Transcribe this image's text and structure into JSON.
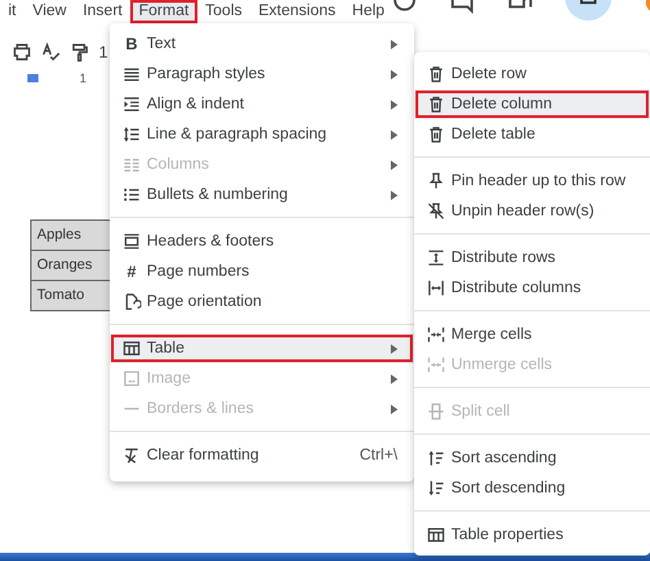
{
  "menubar": {
    "items": [
      {
        "label": "it",
        "selected": false
      },
      {
        "label": "View",
        "selected": false
      },
      {
        "label": "Insert",
        "selected": false
      },
      {
        "label": "Format",
        "selected": true
      },
      {
        "label": "Tools",
        "selected": false
      },
      {
        "label": "Extensions",
        "selected": false
      },
      {
        "label": "Help",
        "selected": false
      }
    ]
  },
  "toolbar": {
    "zoom_text": "1"
  },
  "ruler": {
    "mark": "1"
  },
  "document": {
    "table": {
      "rows": [
        "Apples",
        "Oranges",
        "Tomato"
      ]
    }
  },
  "format_menu": {
    "items": [
      {
        "kind": "item",
        "label": "Text",
        "icon_text": "B",
        "disabled": false,
        "highlighted": false,
        "has_submenu": true
      },
      {
        "kind": "item",
        "label": "Paragraph styles",
        "disabled": false,
        "highlighted": false,
        "has_submenu": true
      },
      {
        "kind": "item",
        "label": "Align & indent",
        "disabled": false,
        "highlighted": false,
        "has_submenu": true
      },
      {
        "kind": "item",
        "label": "Line & paragraph spacing",
        "disabled": false,
        "highlighted": false,
        "has_submenu": true
      },
      {
        "kind": "item",
        "label": "Columns",
        "disabled": true,
        "highlighted": false,
        "has_submenu": true
      },
      {
        "kind": "item",
        "label": "Bullets & numbering",
        "disabled": false,
        "highlighted": false,
        "has_submenu": true
      },
      {
        "kind": "divider"
      },
      {
        "kind": "item",
        "label": "Headers & footers",
        "disabled": false,
        "highlighted": false,
        "has_submenu": false
      },
      {
        "kind": "item",
        "label": "Page numbers",
        "icon_text": "#",
        "disabled": false,
        "highlighted": false,
        "has_submenu": false
      },
      {
        "kind": "item",
        "label": "Page orientation",
        "disabled": false,
        "highlighted": false,
        "has_submenu": false
      },
      {
        "kind": "divider"
      },
      {
        "kind": "item",
        "label": "Table",
        "disabled": false,
        "highlighted": true,
        "has_submenu": true
      },
      {
        "kind": "item",
        "label": "Image",
        "disabled": true,
        "highlighted": false,
        "has_submenu": true
      },
      {
        "kind": "item",
        "label": "Borders & lines",
        "disabled": true,
        "highlighted": false,
        "has_submenu": true
      },
      {
        "kind": "divider"
      },
      {
        "kind": "item",
        "label": "Clear formatting",
        "shortcut": "Ctrl+\\",
        "disabled": false,
        "highlighted": false,
        "has_submenu": false
      }
    ]
  },
  "table_submenu": {
    "items": [
      {
        "kind": "item",
        "label": "Delete row",
        "disabled": false,
        "highlighted": false
      },
      {
        "kind": "item",
        "label": "Delete column",
        "disabled": false,
        "highlighted": true
      },
      {
        "kind": "item",
        "label": "Delete table",
        "disabled": false,
        "highlighted": false
      },
      {
        "kind": "divider"
      },
      {
        "kind": "item",
        "label": "Pin header up to this row",
        "disabled": false,
        "highlighted": false
      },
      {
        "kind": "item",
        "label": "Unpin header row(s)",
        "disabled": false,
        "highlighted": false
      },
      {
        "kind": "divider"
      },
      {
        "kind": "item",
        "label": "Distribute rows",
        "disabled": false,
        "highlighted": false
      },
      {
        "kind": "item",
        "label": "Distribute columns",
        "disabled": false,
        "highlighted": false
      },
      {
        "kind": "divider"
      },
      {
        "kind": "item",
        "label": "Merge cells",
        "disabled": false,
        "highlighted": false
      },
      {
        "kind": "item",
        "label": "Unmerge cells",
        "disabled": true,
        "highlighted": false
      },
      {
        "kind": "divider"
      },
      {
        "kind": "item",
        "label": "Split cell",
        "disabled": true,
        "highlighted": false
      },
      {
        "kind": "divider"
      },
      {
        "kind": "item",
        "label": "Sort ascending",
        "disabled": false,
        "highlighted": false
      },
      {
        "kind": "item",
        "label": "Sort descending",
        "disabled": false,
        "highlighted": false
      },
      {
        "kind": "divider"
      },
      {
        "kind": "item",
        "label": "Table properties",
        "disabled": false,
        "highlighted": false
      }
    ]
  }
}
